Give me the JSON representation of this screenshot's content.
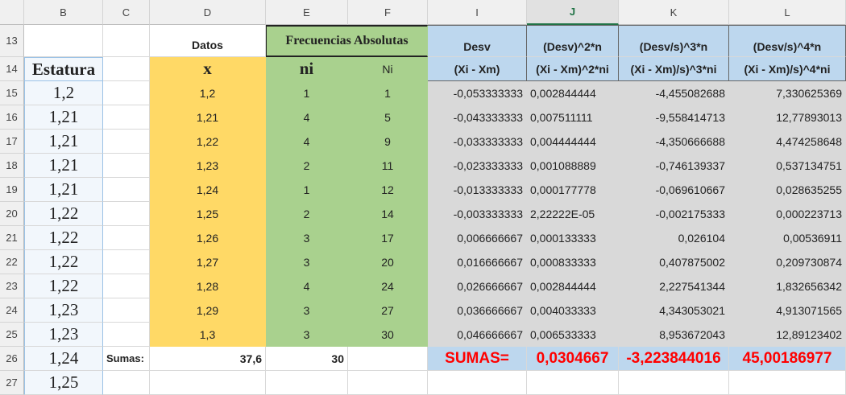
{
  "columns": [
    "B",
    "C",
    "D",
    "E",
    "F",
    "I",
    "J",
    "K",
    "L"
  ],
  "active_column": "J",
  "rows": [
    "13",
    "14",
    "15",
    "16",
    "17",
    "18",
    "19",
    "20",
    "21",
    "22",
    "23",
    "24",
    "25",
    "26",
    "27"
  ],
  "headers": {
    "datos": "Datos",
    "frecuencias": "Frecuencias Absolutas",
    "estatura": "Estatura",
    "x": "x",
    "ni": "ni",
    "Ni": "Ni",
    "desv_top": "Desv",
    "desv_bottom": "(Xi - Xm)",
    "j_top": "(Desv)^2*n",
    "j_bottom": "(Xi - Xm)^2*ni",
    "k_top": "(Desv/s)^3*n",
    "k_bottom": "(Xi - Xm)/s)^3*ni",
    "l_top": "(Desv/s)^4*n",
    "l_bottom": "(Xi - Xm)/s)^4*ni"
  },
  "estatura": [
    "1,2",
    "1,21",
    "1,21",
    "1,21",
    "1,21",
    "1,22",
    "1,22",
    "1,22",
    "1,22",
    "1,23",
    "1,23",
    "1,24",
    "1,25"
  ],
  "table": [
    {
      "x": "1,2",
      "ni": "1",
      "Ni": "1",
      "desv": "-0,053333333",
      "j": "0,002844444",
      "k": "-4,455082688",
      "l": "7,330625369"
    },
    {
      "x": "1,21",
      "ni": "4",
      "Ni": "5",
      "desv": "-0,043333333",
      "j": "0,007511111",
      "k": "-9,558414713",
      "l": "12,77893013"
    },
    {
      "x": "1,22",
      "ni": "4",
      "Ni": "9",
      "desv": "-0,033333333",
      "j": "0,004444444",
      "k": "-4,350666688",
      "l": "4,474258648"
    },
    {
      "x": "1,23",
      "ni": "2",
      "Ni": "11",
      "desv": "-0,023333333",
      "j": "0,001088889",
      "k": "-0,746139337",
      "l": "0,537134751"
    },
    {
      "x": "1,24",
      "ni": "1",
      "Ni": "12",
      "desv": "-0,013333333",
      "j": "0,000177778",
      "k": "-0,069610667",
      "l": "0,028635255"
    },
    {
      "x": "1,25",
      "ni": "2",
      "Ni": "14",
      "desv": "-0,003333333",
      "j": "2,22222E-05",
      "k": "-0,002175333",
      "l": "0,000223713"
    },
    {
      "x": "1,26",
      "ni": "3",
      "Ni": "17",
      "desv": "0,006666667",
      "j": "0,000133333",
      "k": "0,026104",
      "l": "0,00536911"
    },
    {
      "x": "1,27",
      "ni": "3",
      "Ni": "20",
      "desv": "0,016666667",
      "j": "0,000833333",
      "k": "0,407875002",
      "l": "0,209730874"
    },
    {
      "x": "1,28",
      "ni": "4",
      "Ni": "24",
      "desv": "0,026666667",
      "j": "0,002844444",
      "k": "2,227541344",
      "l": "1,832656342"
    },
    {
      "x": "1,29",
      "ni": "3",
      "Ni": "27",
      "desv": "0,036666667",
      "j": "0,004033333",
      "k": "4,343053021",
      "l": "4,913071565"
    },
    {
      "x": "1,3",
      "ni": "3",
      "Ni": "30",
      "desv": "0,046666667",
      "j": "0,006533333",
      "k": "8,953672043",
      "l": "12,89123402"
    }
  ],
  "totals": {
    "sumas_label": "Sumas:",
    "x_sum": "37,6",
    "ni_sum": "30",
    "sumas_upper": "SUMAS=",
    "j_sum": "0,0304667",
    "k_sum": "-3,223844016",
    "l_sum": "45,00186977"
  },
  "colors": {
    "yellow": "#ffd966",
    "green": "#a9d18e",
    "gray": "#d9d9d9",
    "blue": "#bdd7ee",
    "red": "#ff0000"
  }
}
